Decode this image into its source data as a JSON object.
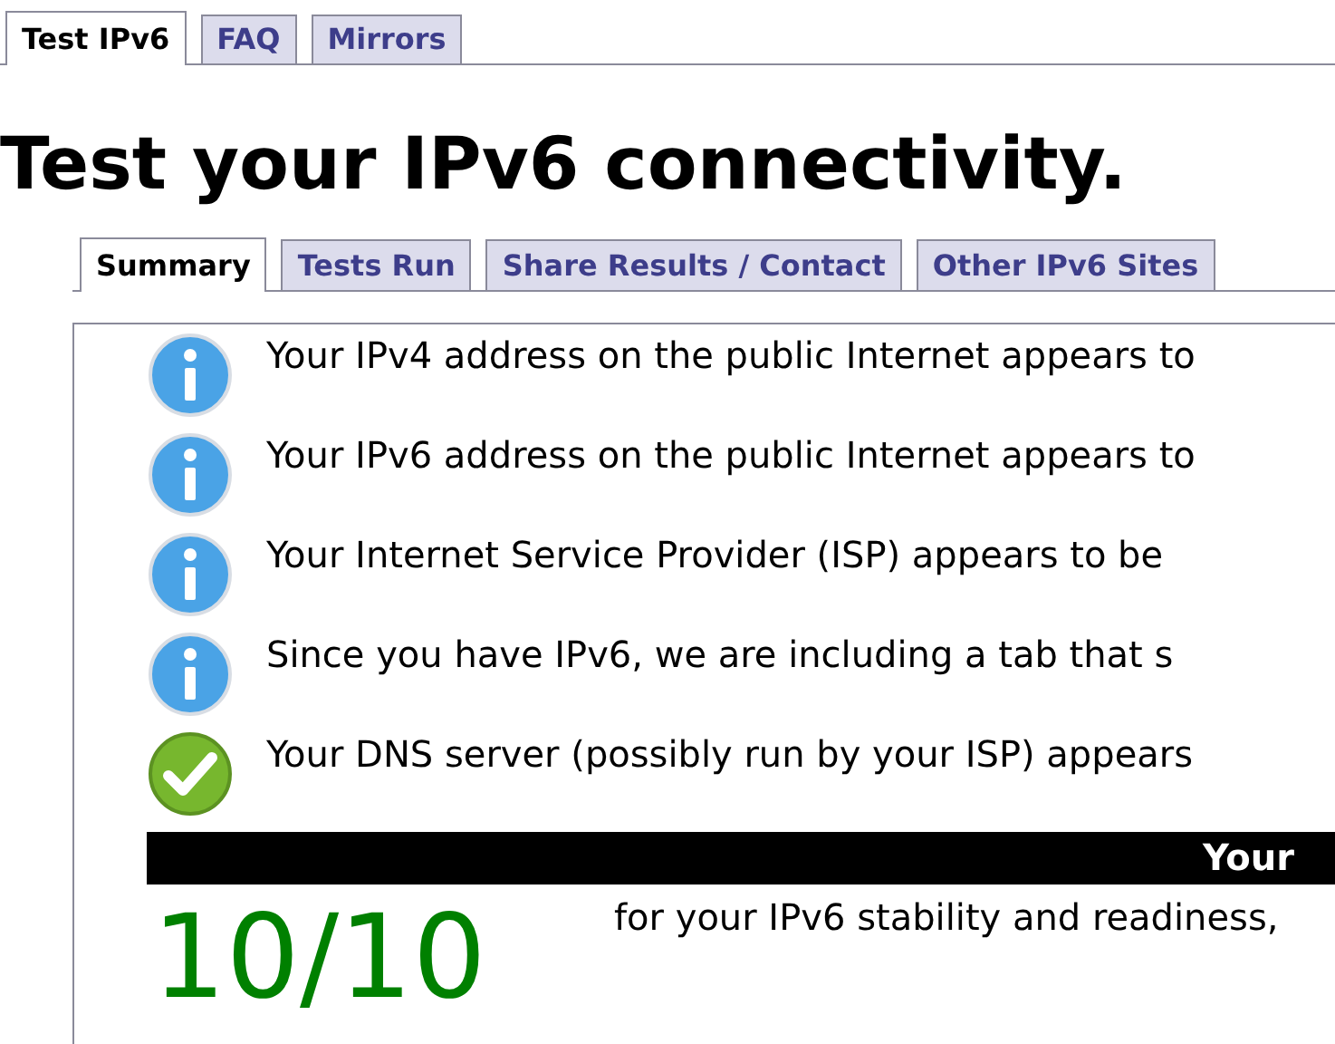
{
  "top_tabs": [
    {
      "label": "Test IPv6",
      "selected": true
    },
    {
      "label": "FAQ",
      "selected": false
    },
    {
      "label": "Mirrors",
      "selected": false
    }
  ],
  "heading": "Test your IPv6 connectivity.",
  "inner_tabs": [
    {
      "label": "Summary",
      "selected": true
    },
    {
      "label": "Tests Run",
      "selected": false
    },
    {
      "label": "Share Results / Contact",
      "selected": false
    },
    {
      "label": "Other IPv6 Sites",
      "selected": false
    }
  ],
  "results": [
    {
      "kind": "info",
      "text": "Your IPv4 address on the public Internet appears to"
    },
    {
      "kind": "info",
      "text": "Your IPv6 address on the public Internet appears to"
    },
    {
      "kind": "info",
      "text": "Your Internet Service Provider (ISP) appears to be"
    },
    {
      "kind": "info",
      "text": "Since you have IPv6, we are including a tab that s"
    },
    {
      "kind": "ok",
      "text": "Your DNS server (possibly run by your ISP) appears"
    }
  ],
  "score_banner": "Your",
  "score": "10/10",
  "score_caption": "for your IPv6 stability and readiness,"
}
